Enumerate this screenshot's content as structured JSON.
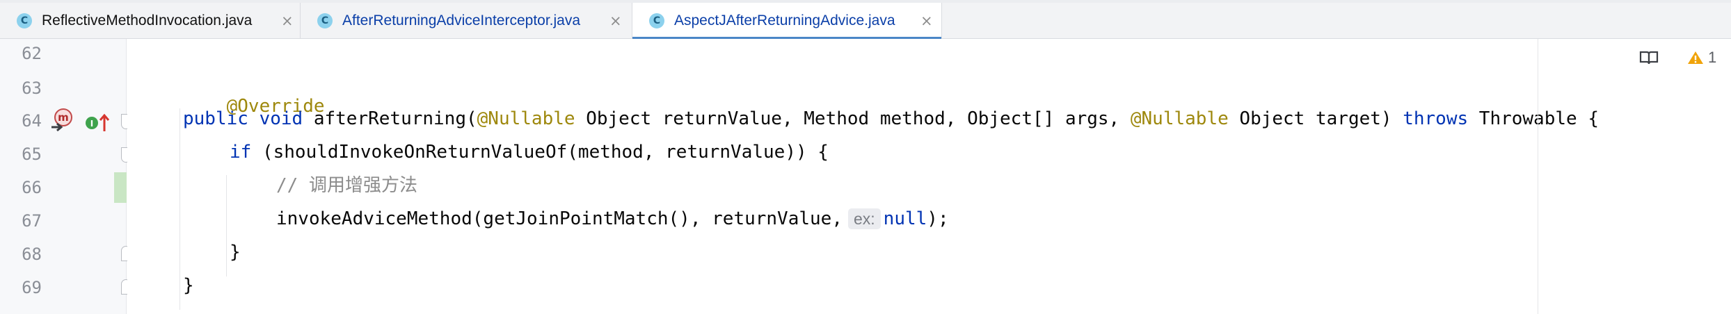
{
  "tabs": [
    {
      "label": "ReflectiveMethodInvocation.java",
      "icon": "java-class-icon",
      "active": false
    },
    {
      "label": "AfterReturningAdviceInterceptor.java",
      "icon": "java-class-icon",
      "active": false
    },
    {
      "label": "AspectJAfterReturningAdvice.java",
      "icon": "java-class-icon",
      "active": true
    }
  ],
  "tab_icon_letter": "C",
  "close_glyph": "×",
  "line_numbers": [
    "62",
    "63",
    "64",
    "65",
    "66",
    "67",
    "68",
    "69"
  ],
  "gutter": {
    "method_icon_letter": "m",
    "overrides_icon": "implemented-method-up-arrow-icon"
  },
  "code": {
    "l63_annotation": "@Override",
    "l64_kw1": "public void ",
    "l64_name": "afterReturning(",
    "l64_ann1": "@Nullable",
    "l64_mid": " Object returnValue, Method method, Object[] args, ",
    "l64_ann2": "@Nullable",
    "l64_tail": " Object target) ",
    "l64_throws": "throws",
    "l64_end": " Throwable {",
    "l65_kw": "if",
    "l65_rest": " (shouldInvokeOnReturnValueOf(method, returnValue)) {",
    "l66_comment": "// 调用增强方法",
    "l67_start": "invokeAdviceMethod(getJoinPointMatch(), returnValue,",
    "l67_hint": "ex:",
    "l67_null": "null",
    "l67_end": ");",
    "l68": "}",
    "l69": "}"
  },
  "indicators": {
    "reader_mode_icon": "book-icon",
    "warning_icon": "warning-triangle-icon",
    "warning_count": "1"
  },
  "colors": {
    "keyword": "#0033b3",
    "annotation": "#9e880d",
    "comment": "#8c8c8c",
    "active_tab_underline": "#4a86c7",
    "warning": "#f0a30a"
  }
}
